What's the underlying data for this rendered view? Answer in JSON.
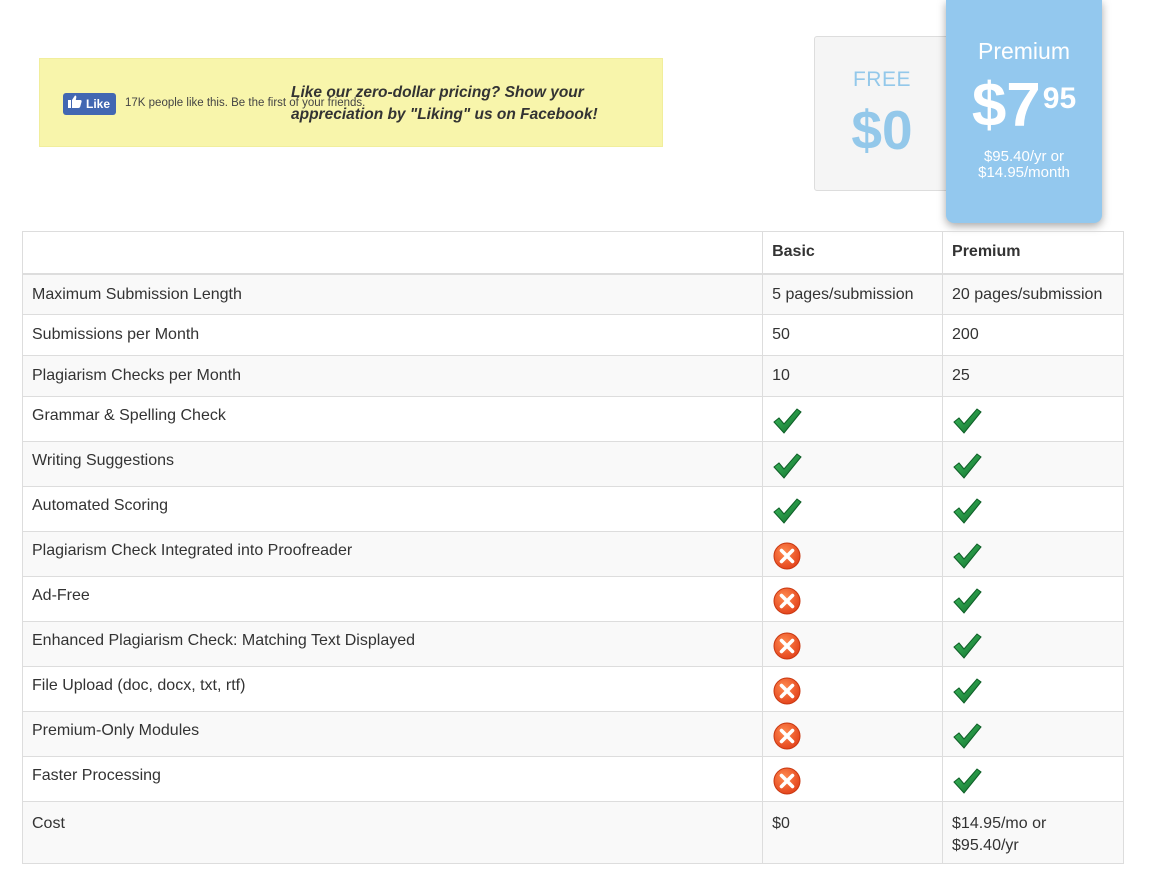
{
  "facebook": {
    "like_label": "Like",
    "count_text": "17K people like this. Be the first of your friends.",
    "message": "Like our zero-dollar pricing? Show your appreciation by \"Liking\" us on Facebook!"
  },
  "plans": {
    "free": {
      "name": "FREE",
      "price": "$0"
    },
    "premium": {
      "name": "Premium",
      "price_main": "$7",
      "price_cents": "95",
      "alt_price": "$95.40/yr or $14.95/month"
    }
  },
  "colors": {
    "accent_blue": "#93c8ee",
    "check_green": "#1e8a3e",
    "cross_orange": "#f04e23",
    "banner_yellow": "#f8f5ab"
  },
  "table": {
    "headers": [
      "",
      "Basic",
      "Premium"
    ],
    "rows": [
      {
        "feature": "Maximum Submission Length",
        "basic": "5 pages/submission",
        "premium": "20 pages/submission"
      },
      {
        "feature": "Submissions per Month",
        "basic": "50",
        "premium": "200"
      },
      {
        "feature": "Plagiarism Checks per Month",
        "basic": "10",
        "premium": "25"
      },
      {
        "feature": "Grammar & Spelling Check",
        "basic": "check-icon",
        "premium": "check-icon"
      },
      {
        "feature": "Writing Suggestions",
        "basic": "check-icon",
        "premium": "check-icon"
      },
      {
        "feature": "Automated Scoring",
        "basic": "check-icon",
        "premium": "check-icon"
      },
      {
        "feature": "Plagiarism Check Integrated into Proofreader",
        "basic": "cross-icon",
        "premium": "check-icon"
      },
      {
        "feature": "Ad-Free",
        "basic": "cross-icon",
        "premium": "check-icon"
      },
      {
        "feature": "Enhanced Plagiarism Check: Matching Text Displayed",
        "basic": "cross-icon",
        "premium": "check-icon"
      },
      {
        "feature": "File Upload (doc, docx, txt, rtf)",
        "basic": "cross-icon",
        "premium": "check-icon"
      },
      {
        "feature": "Premium-Only Modules",
        "basic": "cross-icon",
        "premium": "check-icon"
      },
      {
        "feature": "Faster Processing",
        "basic": "cross-icon",
        "premium": "check-icon"
      }
    ],
    "cost": {
      "feature": "Cost",
      "basic": "$0",
      "premium_line1": "$14.95/mo or",
      "premium_line2": "$95.40/yr"
    }
  }
}
